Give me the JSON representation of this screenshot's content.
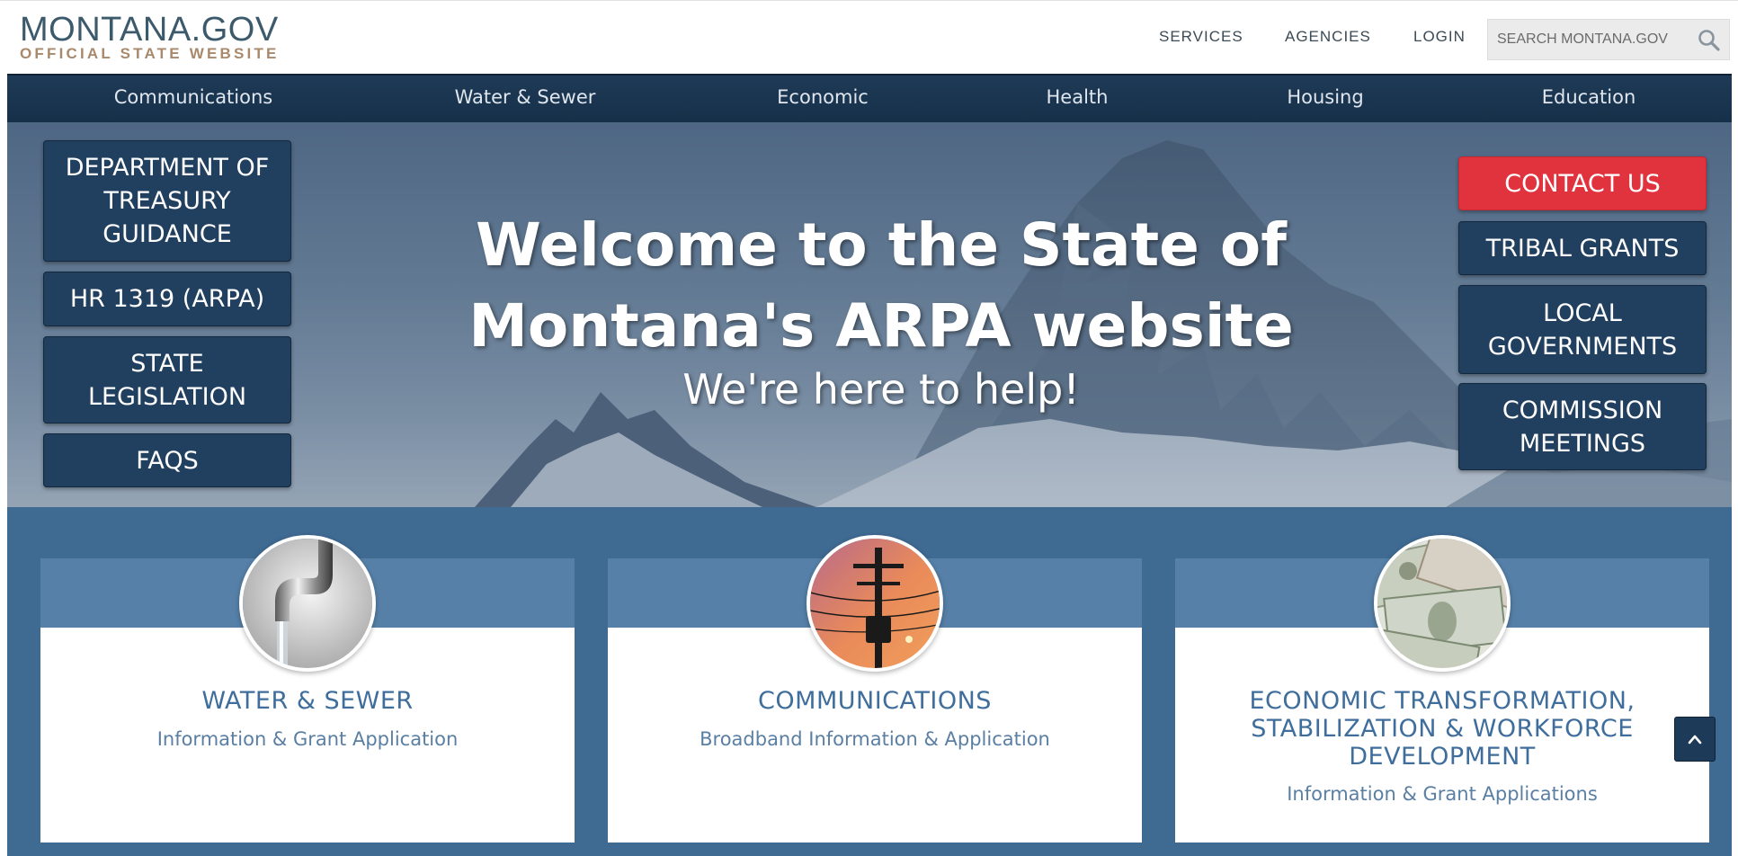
{
  "header": {
    "logo_main": "MONTANA.GOV",
    "logo_sub": "OFFICIAL STATE WEBSITE",
    "util_nav": [
      "SERVICES",
      "AGENCIES",
      "LOGIN"
    ],
    "search_placeholder": "SEARCH MONTANA.GOV"
  },
  "main_nav": [
    "Communications",
    "Water & Sewer",
    "Economic",
    "Health",
    "Housing",
    "Education"
  ],
  "hero": {
    "title": "Welcome to the State of Montana's ARPA website",
    "subtitle": "We're here to help!",
    "left_buttons": [
      "DEPARTMENT OF TREASURY GUIDANCE",
      "HR 1319 (ARPA)",
      "STATE LEGISLATION",
      "FAQS"
    ],
    "right_buttons": [
      "CONTACT US",
      "TRIBAL GRANTS",
      "LOCAL GOVERNMENTS",
      "COMMISSION MEETINGS"
    ]
  },
  "cards": [
    {
      "title": "WATER & SEWER",
      "desc": "Information & Grant Application",
      "image": "faucet-photo"
    },
    {
      "title": "COMMUNICATIONS",
      "desc": "Broadband Information & Application",
      "image": "utility-pole-photo"
    },
    {
      "title": "ECONOMIC TRANSFORMATION, STABILIZATION & WORKFORCE DEVELOPMENT",
      "desc": "Information & Grant Applications",
      "image": "money-photo"
    }
  ],
  "colors": {
    "nav_bg": "#1f3a56",
    "button_bg": "#213f5e",
    "contact_red": "#e1333e",
    "cards_bg": "#3f6a92",
    "card_title": "#3f6e9c"
  },
  "icons": {
    "search": "search-icon",
    "scroll_top": "chevron-up-icon"
  }
}
